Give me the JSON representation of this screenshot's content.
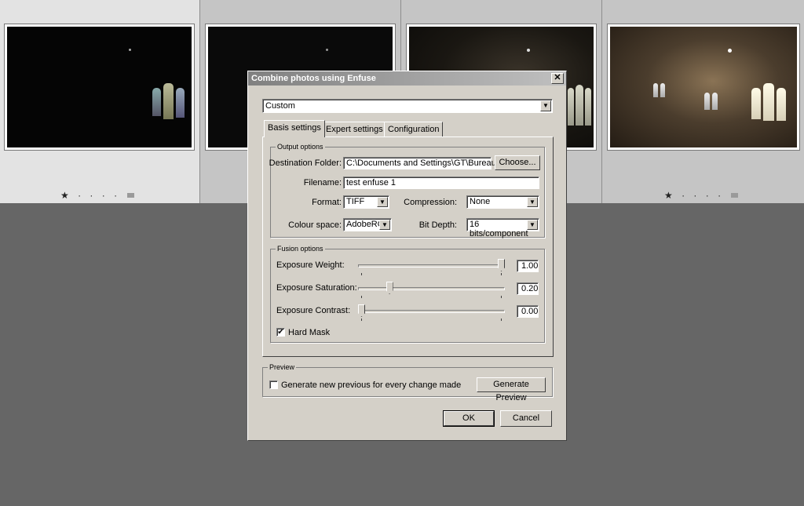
{
  "filmstrip": {
    "ratings": [
      "★ · · · ·",
      "★ · · · ·"
    ]
  },
  "dialog": {
    "title": "Combine photos using Enfuse",
    "close_glyph": "✕",
    "preset": "Custom",
    "tabs": [
      "Basis settings",
      "Expert settings",
      "Configuration"
    ],
    "output_options": {
      "group_label": "Output options",
      "destination_label": "Destination Folder:",
      "destination_value": "C:\\Documents and Settings\\GT\\Bureau",
      "choose_label": "Choose...",
      "filename_label": "Filename:",
      "filename_value": "test enfuse 1",
      "format_label": "Format:",
      "format_value": "TIFF",
      "compression_label": "Compression:",
      "compression_value": "None",
      "colour_space_label": "Colour space:",
      "colour_space_value": "AdobeRGB",
      "bit_depth_label": "Bit Depth:",
      "bit_depth_value": "16 bits/component"
    },
    "fusion_options": {
      "group_label": "Fusion options",
      "sliders": [
        {
          "label": "Exposure Weight:",
          "value": "1.00",
          "level": 1.0
        },
        {
          "label": "Exposure Saturation:",
          "value": "0.20",
          "level": 0.2
        },
        {
          "label": "Exposure Contrast:",
          "value": "0.00",
          "level": 0.0
        }
      ],
      "hard_mask_label": "Hard Mask",
      "hard_mask_checked": true
    },
    "preview": {
      "group_label": "Preview",
      "generate_every_label": "Generate new previous for every change made",
      "generate_every_checked": false,
      "generate_button": "Generate Preview"
    },
    "ok_label": "OK",
    "cancel_label": "Cancel"
  }
}
